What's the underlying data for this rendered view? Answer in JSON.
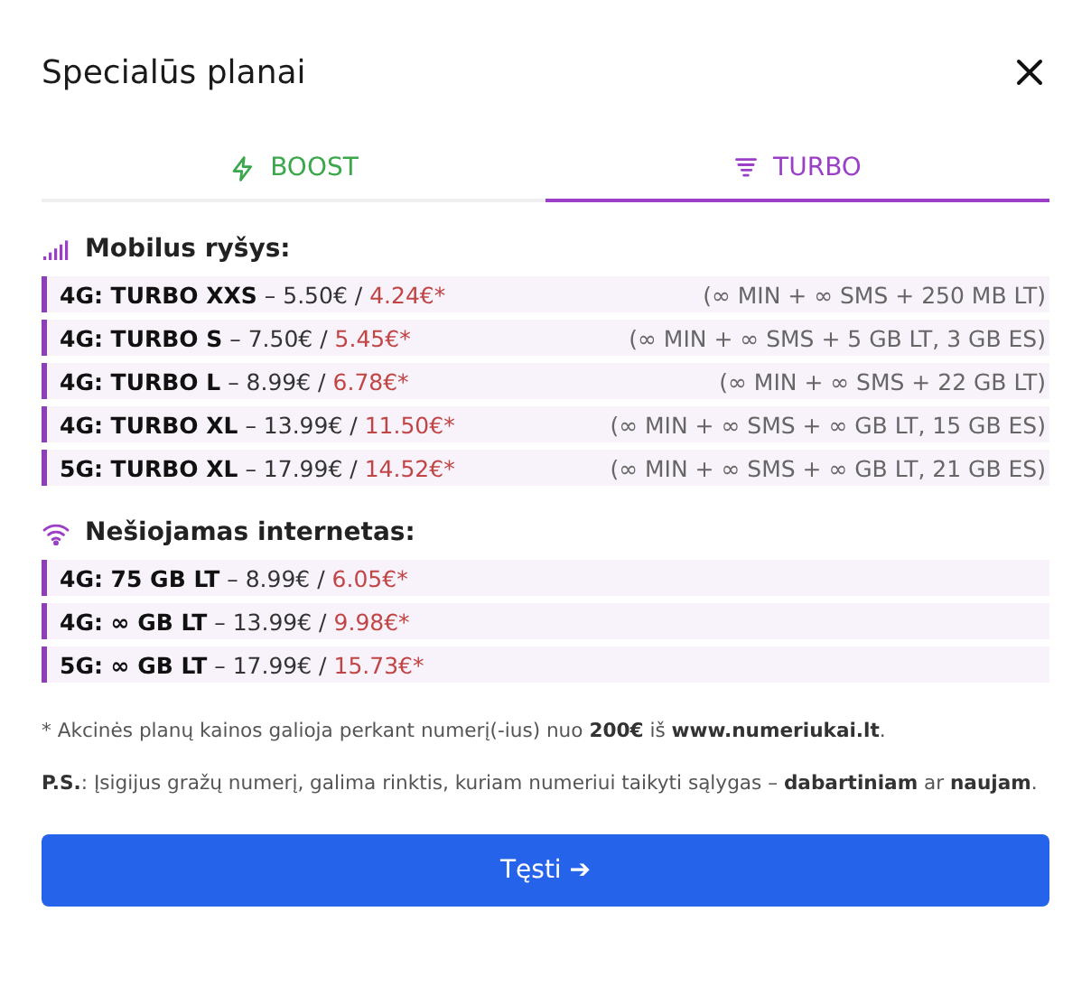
{
  "dialog": {
    "title": "Specialūs planai"
  },
  "tabs": [
    {
      "label": "BOOST",
      "selected": false,
      "color": "#3aa84a"
    },
    {
      "label": "TURBO",
      "selected": true,
      "color": "#9b3fc7"
    }
  ],
  "sections": [
    {
      "kind": "signal",
      "heading": "Mobilus ryšys:",
      "rows": [
        {
          "name": "4G: TURBO XXS",
          "old_price": "– 5.50€ /",
          "new_price": "4.24€*",
          "details": "(∞ MIN + ∞ SMS + 250 MB LT)"
        },
        {
          "name": "4G: TURBO S",
          "old_price": "– 7.50€ /",
          "new_price": "5.45€*",
          "details": "(∞ MIN + ∞ SMS + 5 GB LT, 3 GB ES)"
        },
        {
          "name": "4G: TURBO L",
          "old_price": "– 8.99€ /",
          "new_price": "6.78€*",
          "details": "(∞ MIN + ∞ SMS + 22 GB LT)"
        },
        {
          "name": "4G: TURBO XL",
          "old_price": "– 13.99€ /",
          "new_price": "11.50€*",
          "details": "(∞ MIN + ∞ SMS + ∞ GB LT, 15 GB ES)"
        },
        {
          "name": "5G: TURBO XL",
          "old_price": "– 17.99€ /",
          "new_price": "14.52€*",
          "details": "(∞ MIN + ∞ SMS + ∞ GB LT, 21 GB ES)"
        }
      ]
    },
    {
      "kind": "wifi",
      "heading": "Nešiojamas internetas:",
      "rows": [
        {
          "name": "4G: 75 GB LT",
          "old_price": "– 8.99€ /",
          "new_price": "6.05€*"
        },
        {
          "name": "4G: ∞ GB LT",
          "old_price": "– 13.99€ /",
          "new_price": "9.98€*"
        },
        {
          "name": "5G: ∞ GB LT",
          "old_price": "– 17.99€ /",
          "new_price": "15.73€*"
        }
      ]
    }
  ],
  "notes": [
    "* Akcinės planų kainos galioja perkant numerį(-ius) nuo **200€** iš **www.numeriukai.lt**.",
    "**P.S.**: Įsigijus gražų numerį, galima rinktis, kuriam numeriui taikyti sąlygas – **dabartiniam** ar **naujam**."
  ],
  "button": {
    "label": "Tęsti ➔"
  }
}
